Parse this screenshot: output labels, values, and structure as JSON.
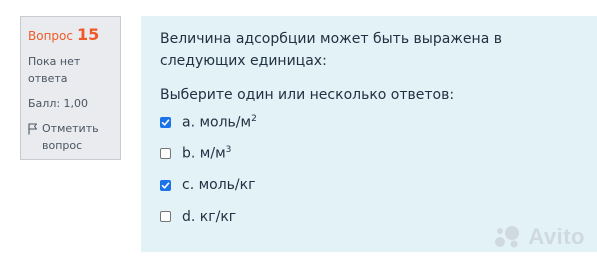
{
  "question_info": {
    "question_word": "Вопрос",
    "question_number": "15",
    "state": "Пока нет ответа",
    "grade": "Балл: 1,00",
    "flag_label": "Отметить вопрос"
  },
  "question": {
    "text": "Величина адсорбции может быть выражена в следующих единицах:",
    "prompt": "Выберите один или несколько ответов:",
    "answers": [
      {
        "letter": "a.",
        "label": "моль/м",
        "sup": "2",
        "checked": true
      },
      {
        "letter": "b.",
        "label": "м/м",
        "sup": "3",
        "checked": false
      },
      {
        "letter": "c.",
        "label": "моль/кг",
        "sup": "",
        "checked": true
      },
      {
        "letter": "d.",
        "label": "кг/кг",
        "sup": "",
        "checked": false
      }
    ]
  },
  "watermark": {
    "text": "Avito"
  },
  "colors": {
    "accent": "#f05a28",
    "panel_bg": "#e2f2f7",
    "info_bg": "#e9ebee",
    "checkbox": "#1a73e8"
  }
}
